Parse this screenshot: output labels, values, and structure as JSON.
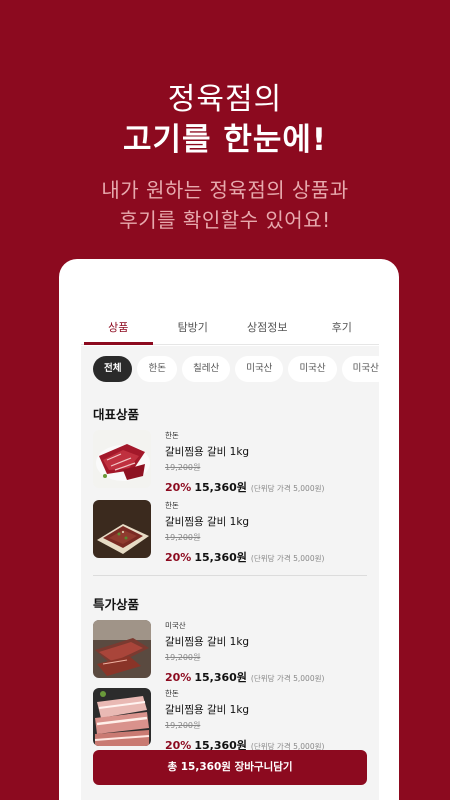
{
  "hero": {
    "line1": "정육점의",
    "line2": "고기를 한눈에!",
    "sub1": "내가 원하는 정육점의 상품과",
    "sub2": "후기를 확인할수 있어요!"
  },
  "tabs": [
    {
      "label": "상품",
      "active": true
    },
    {
      "label": "탐방기",
      "active": false
    },
    {
      "label": "상점정보",
      "active": false
    },
    {
      "label": "후기",
      "active": false
    }
  ],
  "chips": [
    "전체",
    "한돈",
    "칠레산",
    "미국산",
    "미국산",
    "미국산"
  ],
  "sections": [
    {
      "title": "대표상품",
      "items": [
        {
          "origin": "한돈",
          "name": "갈비찜용 갈비 1kg",
          "original_price": "19,200원",
          "discount": "20%",
          "price": "15,360원",
          "unit_price": "(단위당 가격 5,000원)"
        },
        {
          "origin": "한돈",
          "name": "갈비찜용 갈비 1kg",
          "original_price": "19,200원",
          "discount": "20%",
          "price": "15,360원",
          "unit_price": "(단위당 가격 5,000원)"
        }
      ]
    },
    {
      "title": "특가상품",
      "items": [
        {
          "origin": "미국산",
          "name": "갈비찜용 갈비 1kg",
          "original_price": "19,200원",
          "discount": "20%",
          "price": "15,360원",
          "unit_price": "(단위당 가격 5,000원)"
        },
        {
          "origin": "한돈",
          "name": "갈비찜용 갈비 1kg",
          "original_price": "19,200원",
          "discount": "20%",
          "price": "15,360원",
          "unit_price": "(단위당 가격 5,000원)"
        }
      ]
    }
  ],
  "cart_button": "총 15,360원 장바구니담기",
  "colors": {
    "brand": "#8c0a1f",
    "hero_sub": "#e7a9ad",
    "chip_active": "#2a2a2a"
  }
}
